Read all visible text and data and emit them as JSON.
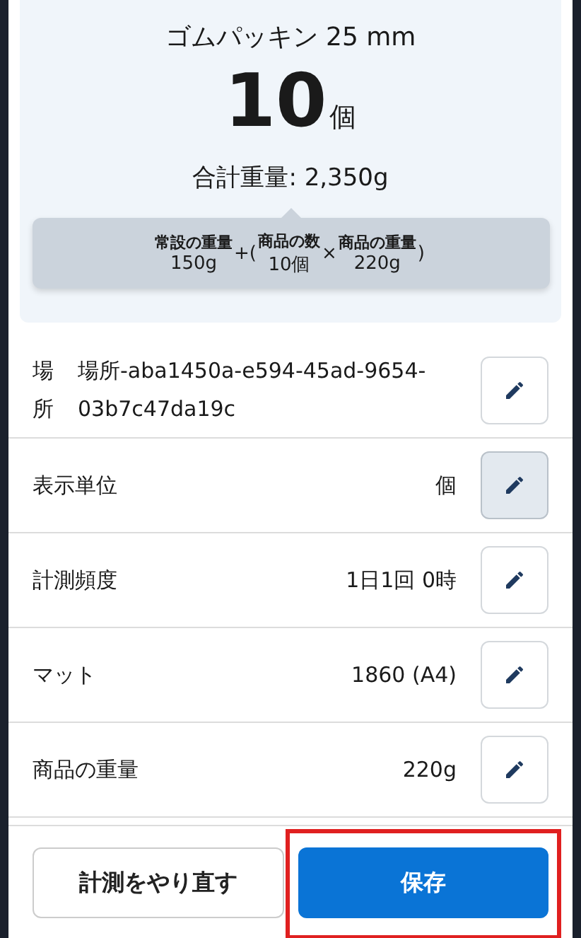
{
  "summary": {
    "product": "ゴムパッキン 25 mm",
    "count": "10",
    "unit": "個",
    "total": "合計重量: 2,350g",
    "formula": [
      {
        "kind": "term",
        "label": "常設の重量",
        "value": "150g"
      },
      {
        "kind": "op",
        "text": "+("
      },
      {
        "kind": "term",
        "label": "商品の数",
        "value": "10個"
      },
      {
        "kind": "op",
        "text": "×"
      },
      {
        "kind": "term",
        "label": "商品の重量",
        "value": "220g"
      },
      {
        "kind": "op",
        "text": ")"
      }
    ]
  },
  "settings": [
    {
      "kind": "stacked",
      "label": "場所",
      "value": "場所-aba1450a-e594-45ad-9654-03b7c47da19c",
      "active": false
    },
    {
      "kind": "inline",
      "label": "表示単位",
      "value": "個",
      "active": true
    },
    {
      "kind": "inline",
      "label": "計測頻度",
      "value": "1日1回 0時",
      "active": false
    },
    {
      "kind": "inline",
      "label": "マット",
      "value": "1860 (A4)",
      "active": false
    },
    {
      "kind": "inline",
      "label": "商品の重量",
      "value": "220g",
      "active": false
    }
  ],
  "buttons": [
    {
      "kind": "secondary",
      "label": "計測をやり直す",
      "highlighted": false
    },
    {
      "kind": "primary",
      "label": "保存",
      "highlighted": true
    }
  ]
}
